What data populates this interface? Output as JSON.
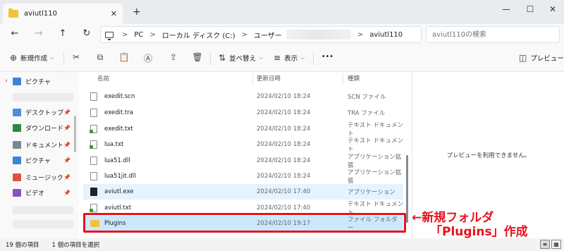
{
  "tab": {
    "title": "aviutl110",
    "close": "✕",
    "new_tab": "+"
  },
  "window": {
    "minimize": "—",
    "maximize": "☐",
    "close": "✕"
  },
  "nav": {
    "back": "←",
    "forward": "→",
    "up": "↑",
    "refresh": "↻"
  },
  "address": {
    "sep": ">",
    "crumbs": [
      "PC",
      "ローカル ディスク (C:)",
      "ユーザー",
      "aviutl110"
    ]
  },
  "search": {
    "placeholder": "aviutl110の検索"
  },
  "toolbar": {
    "new_label": "新規作成",
    "sort_label": "並べ替え",
    "view_label": "表示",
    "more_label": "•••",
    "preview_label": "プレビュー"
  },
  "navpane": {
    "items": [
      {
        "label": "ピクチャ",
        "color": "#3a86d4"
      },
      {
        "label": "デスクトップ",
        "color": "#4a90d9"
      },
      {
        "label": "ダウンロード",
        "color": "#2b8a3e"
      },
      {
        "label": "ドキュメント",
        "color": "#7a8795"
      },
      {
        "label": "ピクチャ",
        "color": "#3a86d4"
      },
      {
        "label": "ミュージック",
        "color": "#e0523b"
      },
      {
        "label": "ビデオ",
        "color": "#8b4fc7"
      }
    ],
    "pin": "📌"
  },
  "columns": {
    "name": "名前",
    "date": "更新日時",
    "type": "種類"
  },
  "files": [
    {
      "name": "exedit.scn",
      "date": "2024/02/10 18:24",
      "type": "SCN ファイル",
      "kind": "file"
    },
    {
      "name": "exedit.tra",
      "date": "2024/02/10 18:24",
      "type": "TRA ファイル",
      "kind": "file"
    },
    {
      "name": "exedit.txt",
      "date": "2024/02/10 18:24",
      "type": "テキスト ドキュメント",
      "kind": "txt"
    },
    {
      "name": "lua.txt",
      "date": "2024/02/10 18:24",
      "type": "テキスト ドキュメント",
      "kind": "txt"
    },
    {
      "name": "lua51.dll",
      "date": "2024/02/10 18:24",
      "type": "アプリケーション拡張",
      "kind": "file"
    },
    {
      "name": "lua51jit.dll",
      "date": "2024/02/10 18:24",
      "type": "アプリケーション拡張",
      "kind": "file"
    },
    {
      "name": "aviutl.exe",
      "date": "2024/02/10 17:40",
      "type": "アプリケーション",
      "kind": "exe"
    },
    {
      "name": "aviutl.txt",
      "date": "2024/02/10 17:40",
      "type": "テキスト ドキュメント",
      "kind": "txt"
    },
    {
      "name": "Plugins",
      "date": "2024/02/10 19:17",
      "type": "ファイル フォルダー",
      "kind": "folder"
    }
  ],
  "preview": {
    "message": "プレビューを利用できません。"
  },
  "annotation": {
    "line1": "←新規フォルダ",
    "line2": "「Plugins」作成"
  },
  "status": {
    "count": "19 個の項目",
    "selected": "1 個の項目を選択"
  },
  "colors": {
    "selection": "#cce8ff",
    "annotation": "#e8121b",
    "folder": "#f3c13a"
  }
}
